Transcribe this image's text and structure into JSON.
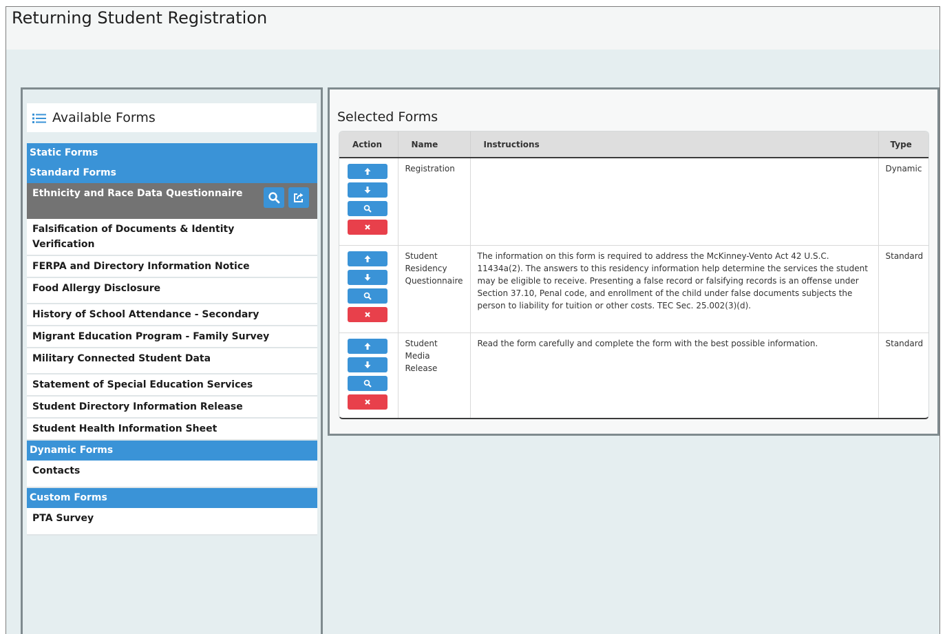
{
  "page": {
    "title": "Returning Student Registration"
  },
  "available_forms": {
    "heading": "Available Forms",
    "heading_icon": "list-icon",
    "sections": {
      "static": {
        "label": "Static Forms"
      },
      "standard": {
        "label": "Standard Forms",
        "items": [
          "Ethnicity and Race Data Questionnaire",
          "Falsification of Documents & Identity Verification",
          "FERPA and Directory Information Notice",
          "Food Allergy Disclosure",
          "History of School Attendance - Secondary",
          "Migrant Education Program - Family Survey",
          "Military Connected Student Data",
          "Statement of Special Education Services",
          "Student Directory Information Release",
          "Student Health Information Sheet"
        ]
      },
      "dynamic": {
        "label": "Dynamic Forms",
        "items": [
          "Contacts"
        ]
      },
      "custom": {
        "label": "Custom Forms",
        "items": [
          "PTA Survey"
        ]
      }
    },
    "active_item_icons": [
      "search-icon",
      "share-icon"
    ]
  },
  "selected_forms": {
    "heading": "Selected Forms",
    "columns": [
      "Action",
      "Name",
      "Instructions",
      "Type"
    ],
    "action_icons": [
      "arrow-up-icon",
      "arrow-down-icon",
      "search-icon",
      "close-icon"
    ],
    "rows": [
      {
        "name": "Registration",
        "instructions": "",
        "type": "Dynamic"
      },
      {
        "name": "Student Residency Questionnaire",
        "instructions": "The information on this form is required to address the McKinney-Vento Act 42 U.S.C. 11434a(2). The answers to this residency information help determine the services the student may be eligible to receive. Presenting a false record or falsifying records is an offense under Section 37.10, Penal code, and enrollment of the child under false documents subjects the person to liability for tuition or other costs. TEC Sec. 25.002(3)(d).",
        "type": "Standard"
      },
      {
        "name": "Student Media Release",
        "instructions": "Read the form carefully and complete the form with the best possible information.",
        "type": "Standard"
      }
    ]
  },
  "colors": {
    "accent_blue": "#3a93d7",
    "danger_red": "#e8404b",
    "active_gray": "#737373"
  }
}
